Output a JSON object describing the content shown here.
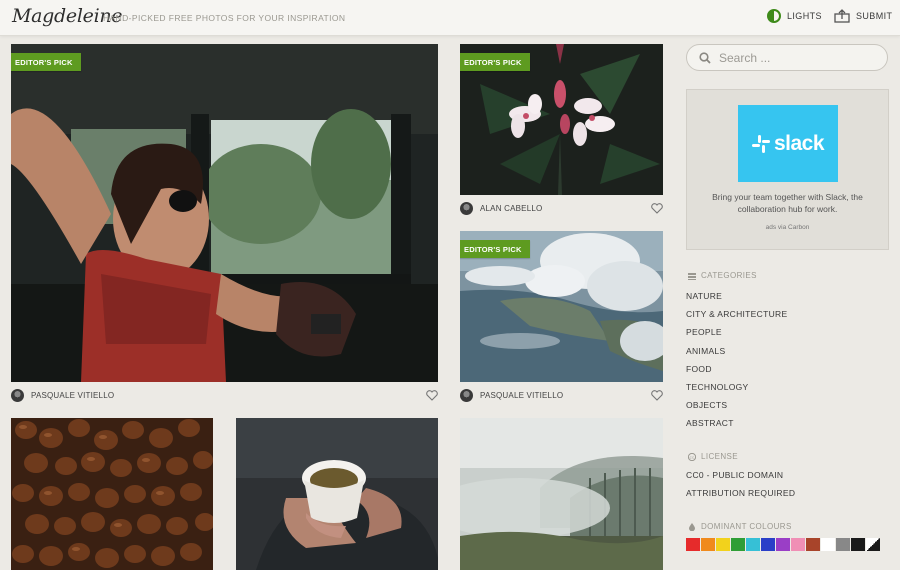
{
  "header": {
    "logo": "Magdeleine",
    "tagline": "HAND-PICKED FREE PHOTOS FOR YOUR INSPIRATION",
    "lights_label": "LIGHTS",
    "submit_label": "SUBMIT"
  },
  "cards": {
    "car_woman": {
      "badge": "EDITOR'S PICK",
      "author": "PASQUALE VITIELLO"
    },
    "flowers": {
      "badge": "EDITOR'S PICK",
      "author": "ALAN CABELLO"
    },
    "clouds": {
      "badge": "EDITOR'S PICK",
      "author": "PASQUALE VITIELLO"
    }
  },
  "search": {
    "placeholder": "Search ..."
  },
  "ad": {
    "brand": "slack",
    "text": "Bring your team together with Slack, the collaboration hub for work.",
    "via": "ads via Carbon",
    "brand_color": "#36c5f0"
  },
  "categories": {
    "title": "CATEGORIES",
    "items": [
      "NATURE",
      "CITY & ARCHITECTURE",
      "PEOPLE",
      "ANIMALS",
      "FOOD",
      "TECHNOLOGY",
      "OBJECTS",
      "ABSTRACT"
    ]
  },
  "license": {
    "title": "LICENSE",
    "items": [
      "CC0 - PUBLIC DOMAIN",
      "ATTRIBUTION REQUIRED"
    ]
  },
  "colours": {
    "title": "DOMINANT COLOURS",
    "swatches": [
      "#e62b2b",
      "#f08a1c",
      "#f2d21c",
      "#2f9e36",
      "#36c0d6",
      "#2a3fc8",
      "#9a3ec6",
      "#f08fb5",
      "#a8442a",
      "#ffffff",
      "#888888",
      "#1a1a1a",
      "#ffffff/#1a1a1a"
    ]
  },
  "colors": {
    "accent_green": "#5e9b20",
    "background": "#eceae5"
  }
}
